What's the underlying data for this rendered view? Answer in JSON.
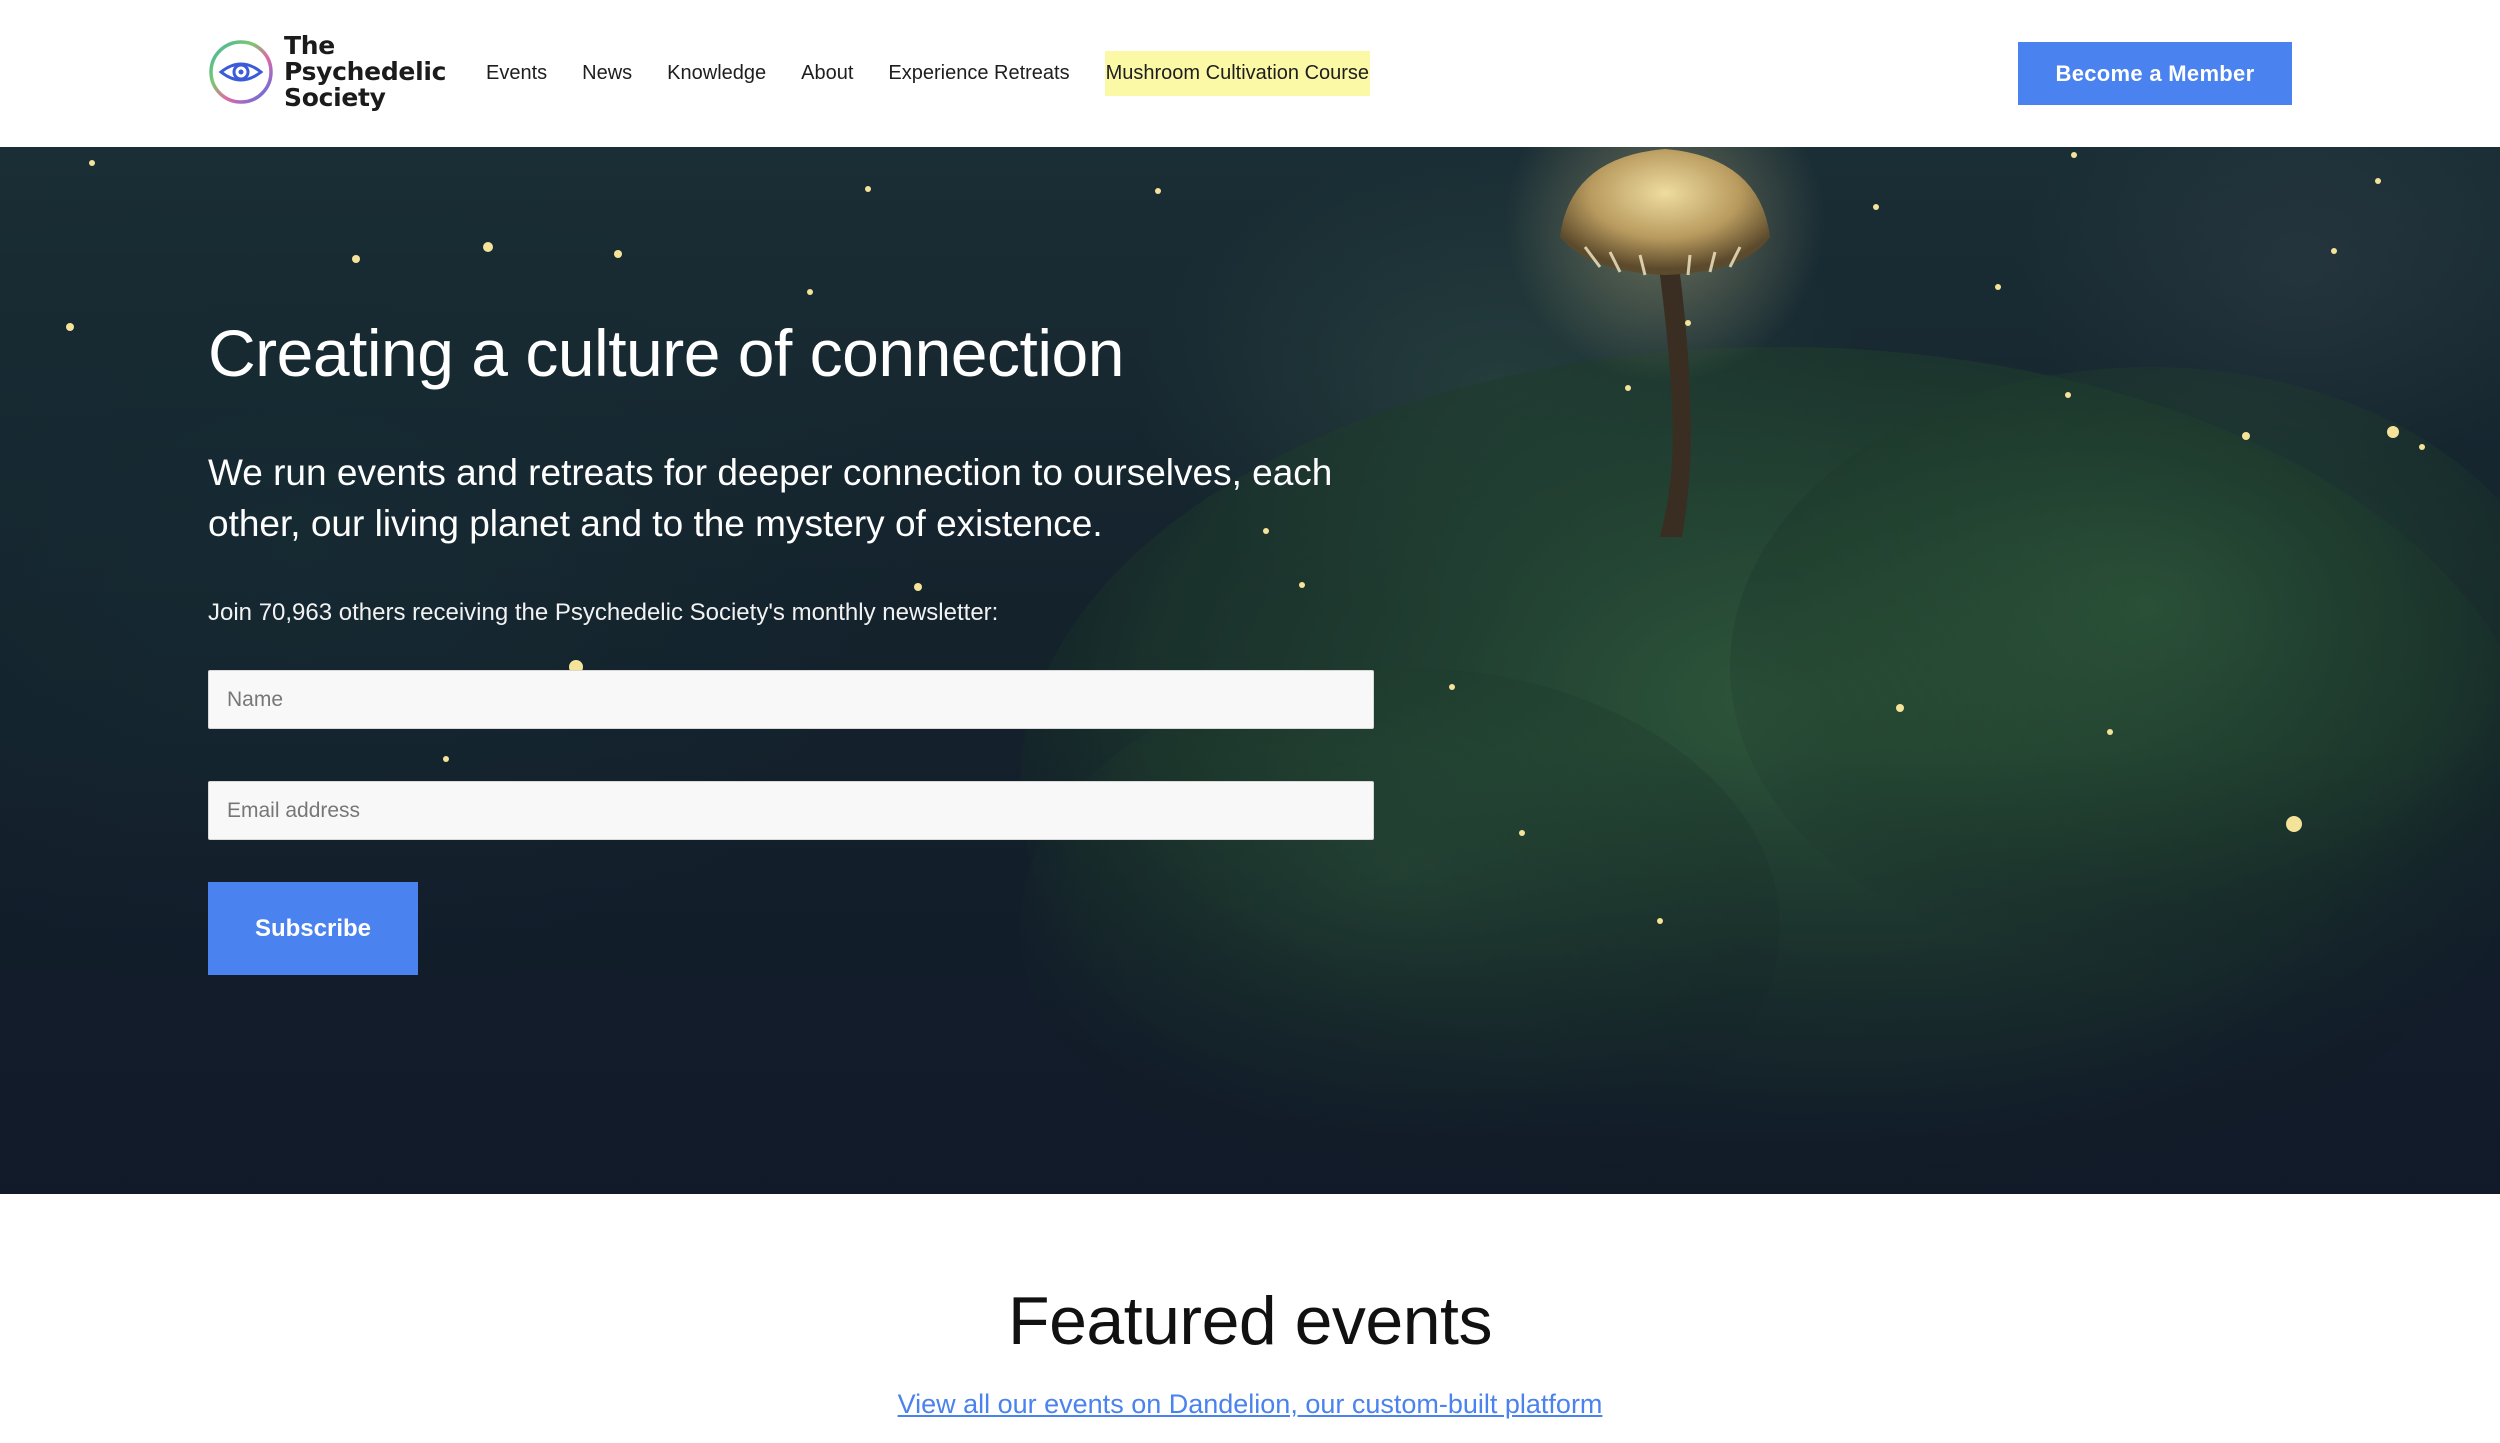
{
  "brand": {
    "name_lines": [
      "The",
      "Psychedelic",
      "Society"
    ],
    "logo_icon": "eye-rainbow-circle-icon"
  },
  "nav": {
    "items": [
      "Events",
      "News",
      "Knowledge",
      "About",
      "Experience Retreats"
    ],
    "highlight_item": "Mushroom Cultivation Course"
  },
  "header": {
    "cta_label": "Become a Member"
  },
  "hero": {
    "title": "Creating a culture of connection",
    "subtitle": "We run events and retreats for deeper connection to ourselves, each other, our living planet and to the mystery of existence.",
    "newsletter_text": "Join 70,963 others receiving the Psychedelic Society's monthly newsletter:",
    "name_placeholder": "Name",
    "email_placeholder": "Email address",
    "subscribe_label": "Subscribe",
    "background": "mushroom-forest-night-image"
  },
  "featured": {
    "title": "Featured events",
    "link_text": "View all our events on Dandelion, our custom-built platform"
  },
  "colors": {
    "accent": "#4a82ef",
    "highlight": "#fbf8a6",
    "hero_dark": "#14222c"
  }
}
